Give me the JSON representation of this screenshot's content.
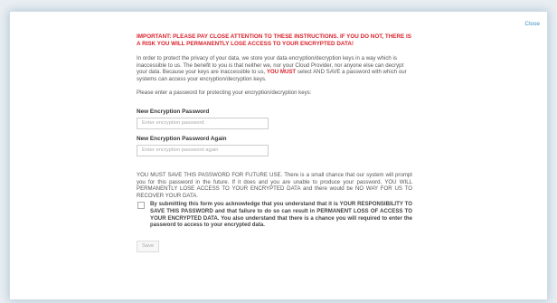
{
  "modal": {
    "close_label": "Close"
  },
  "warning": "IMPORTANT: PLEASE PAY CLOSE ATTENTION TO THESE INSTRUCTIONS. IF YOU DO NOT, THERE IS A RISK YOU WILL PERMANENTLY LOSE ACCESS TO YOUR ENCRYPTED DATA!",
  "privacy": {
    "text_before": "In order to protect the privacy of your data, we store your data encryption/decryption keys in a way which is inaccessible to us. The benefit to you is that neither we, nor your Cloud Provider, nor anyone else can decrypt your data. Because your keys are inaccessible to us, ",
    "must": "YOU MUST",
    "text_after": " select AND SAVE a password with which our systems can access your encryption/decryption keys."
  },
  "prompt": "Please enter a password for protecting your encryption/decryption keys:",
  "fields": {
    "new_label": "New Encryption Password",
    "new_placeholder": "Enter encryption password",
    "again_label": "New Encryption Password Again",
    "again_placeholder": "Enter encryption password again"
  },
  "save_notice": "YOU MUST SAVE THIS PASSWORD FOR FUTURE USE. There is a small chance that our system will prompt you for this password in the future. If it does and you are unable to produce your password, YOU WILL PERMANENTLY LOSE ACCESS TO YOUR ENCRYPTED DATA and there would be NO WAY FOR US TO RECOVER YOUR DATA.",
  "acknowledge": "By submitting this form you acknowledge that you understand that it is YOUR RESPONSIBILITY TO SAVE THIS PASSWORD and that failure to do so can result in PERMANENT LOSS OF ACCESS TO YOUR ENCRYPTED DATA. You also understand that there is a chance you will required to enter the password to access to your encrypted data.",
  "save_label": "Save"
}
